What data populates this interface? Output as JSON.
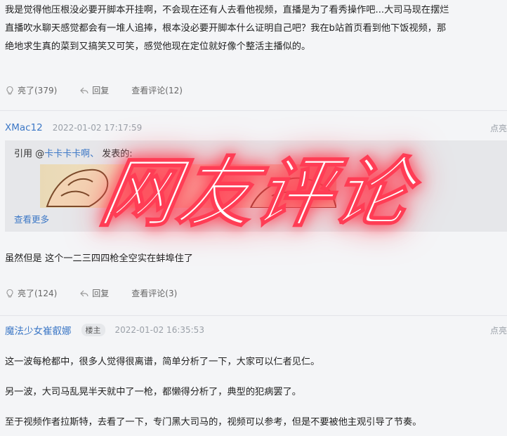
{
  "post1": {
    "lines": [
      "我是觉得他压根没必要开脚本开挂啊，不会现在还有人去看他视频，直播是为了看秀操作吧...大司马现在摆烂",
      "直播吹水聊天感觉都会有一堆人追捧，根本没必要开脚本什么证明自己吧？我在b站首页看到他下饭视频，那",
      "绝地求生真的菜到又搞笑又可笑，感觉他现在定位就好像个整活主播似的。"
    ],
    "like_label": "亮了(379)",
    "reply_label": "回复",
    "view_comments_label": "查看评论(12)"
  },
  "post2": {
    "username": "XMac12",
    "timestamp": "2022-01-02 17:17:59",
    "report_label": "点亮",
    "quote_prefix": "引用 @",
    "quoted_user": "卡卡卡卡啊、",
    "quote_suffix": " 发表的:",
    "see_more_label": "查看更多",
    "text": "虽然但是 这个一二三四四枪全空实在蚌埠住了",
    "like_label": "亮了(124)",
    "reply_label": "回复",
    "view_comments_label": "查看评论(3)"
  },
  "post3": {
    "username": "魔法少女崔叡娜",
    "badge": "楼主",
    "timestamp": "2022-01-02 16:35:53",
    "report_label": "点亮",
    "paragraphs": [
      "这一波每枪都中，很多人觉得很离谱，简单分析了一下，大家可以仁者见仁。",
      "另一波，大司马乱晃半天就中了一枪，都懒得分析了，典型的犯病罢了。",
      "至于视频作者拉斯特，去看了一下，专门黑大司马的，视频可以参考，但是不要被他主观引导了节奏。"
    ]
  },
  "overlay": {
    "text": "网友评论",
    "color": "#ffffff",
    "glow_color": "#ff3d55"
  },
  "icons": {
    "like": "lightbulb-icon",
    "reply": "reply-arrow-icon"
  }
}
